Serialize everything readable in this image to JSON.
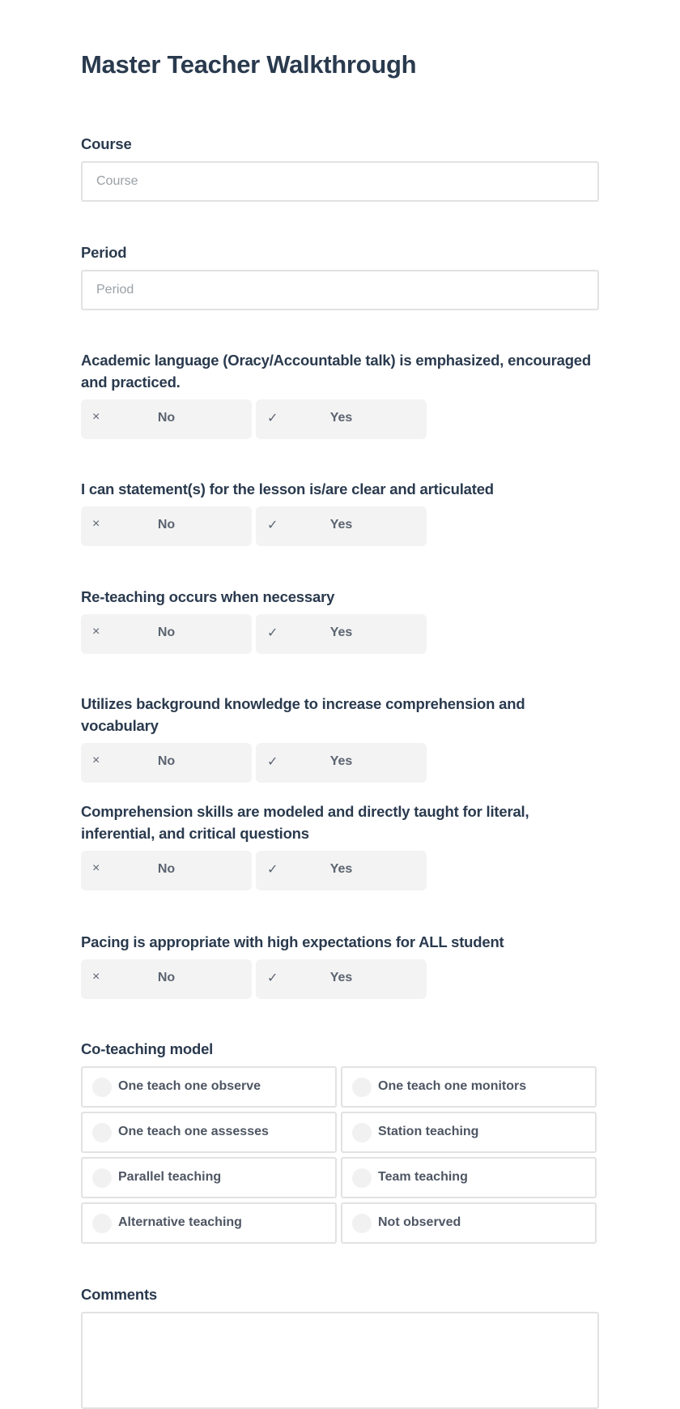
{
  "form": {
    "title": "Master Teacher Walkthrough",
    "course": {
      "label": "Course",
      "placeholder": "Course",
      "value": ""
    },
    "period": {
      "label": "Period",
      "placeholder": "Period",
      "value": ""
    },
    "questions": [
      {
        "label": "Academic language (Oracy/Accountable talk) is emphasized, encouraged and practiced.",
        "no_label": "No",
        "yes_label": "Yes"
      },
      {
        "label": "I can statement(s) for the lesson is/are clear and articulated",
        "no_label": "No",
        "yes_label": "Yes"
      },
      {
        "label": "Re-teaching occurs when necessary",
        "no_label": "No",
        "yes_label": "Yes"
      },
      {
        "label": "Utilizes background knowledge to increase comprehension and vocabulary",
        "no_label": "No",
        "yes_label": "Yes"
      },
      {
        "label": "Comprehension skills are modeled and directly taught for literal, inferential, and critical questions",
        "no_label": "No",
        "yes_label": "Yes"
      },
      {
        "label": "Pacing is appropriate with high expectations for ALL student",
        "no_label": "No",
        "yes_label": "Yes"
      }
    ],
    "icons": {
      "no": "×",
      "yes": "✓"
    },
    "coteaching": {
      "label": "Co-teaching model",
      "options": [
        "One teach one observe",
        "One teach one monitors",
        "One teach one assesses",
        "Station teaching",
        "Parallel teaching",
        "Team teaching",
        "Alternative teaching",
        "Not observed"
      ],
      "selected": null
    },
    "comments": {
      "label": "Comments",
      "value": ""
    }
  }
}
